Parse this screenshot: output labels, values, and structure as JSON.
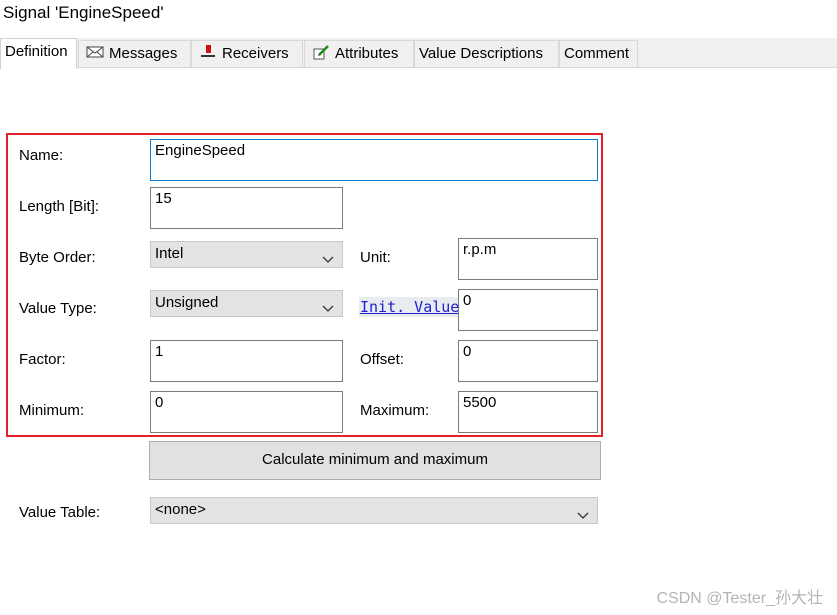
{
  "window": {
    "title": "Signal 'EngineSpeed'"
  },
  "tabs": [
    {
      "label": "Definition",
      "icon": "none",
      "active": true
    },
    {
      "label": "Messages",
      "icon": "envelope-icon"
    },
    {
      "label": "Receivers",
      "icon": "node-icon"
    },
    {
      "label": "Attributes",
      "icon": "edit-pen-icon"
    },
    {
      "label": "Value Descriptions",
      "icon": "none"
    },
    {
      "label": "Comment",
      "icon": "none"
    }
  ],
  "form": {
    "name": {
      "label": "Name:",
      "value": "EngineSpeed"
    },
    "length": {
      "label": "Length [Bit]:",
      "value": "15"
    },
    "byte_order": {
      "label": "Byte Order:",
      "value": "Intel"
    },
    "unit": {
      "label": "Unit:",
      "value": "r.p.m"
    },
    "value_type": {
      "label": "Value Type:",
      "value": "Unsigned"
    },
    "init_value": {
      "label": "Init. Value",
      "value": "0"
    },
    "factor": {
      "label": "Factor:",
      "value": "1"
    },
    "offset": {
      "label": "Offset:",
      "value": "0"
    },
    "minimum": {
      "label": "Minimum:",
      "value": "0"
    },
    "maximum": {
      "label": "Maximum:",
      "value": "5500"
    },
    "calc_button": "Calculate minimum and maximum",
    "value_table": {
      "label": "Value Table:",
      "value": "<none>"
    }
  },
  "highlight_color": "#e0202a",
  "watermark": "CSDN @Tester_孙大壮"
}
